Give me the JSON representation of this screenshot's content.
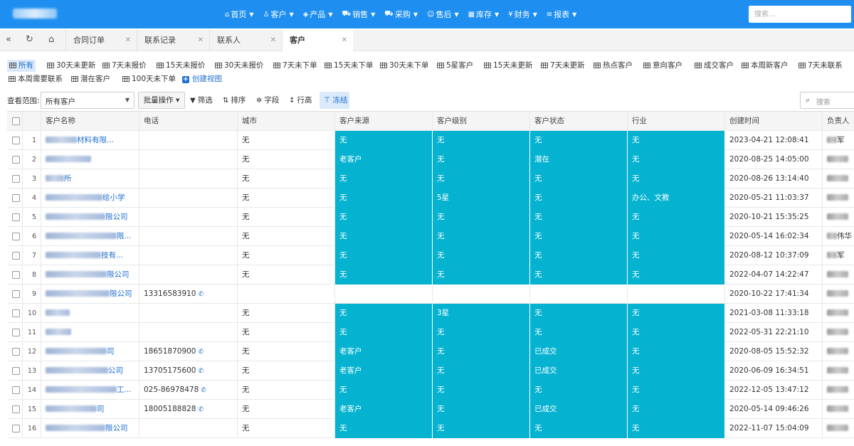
{
  "nav": {
    "items": [
      {
        "icon": "home-icon",
        "glyph": "⌂",
        "label": "首页"
      },
      {
        "icon": "user-icon",
        "glyph": "♙",
        "label": "客户"
      },
      {
        "icon": "cube-icon",
        "glyph": "◈",
        "label": "产品"
      },
      {
        "icon": "cart-icon",
        "glyph": "⛟",
        "label": "销售"
      },
      {
        "icon": "cart-icon",
        "glyph": "⛟",
        "label": "采购"
      },
      {
        "icon": "service-icon",
        "glyph": "☺",
        "label": "售后"
      },
      {
        "icon": "warehouse-icon",
        "glyph": "▦",
        "label": "库存"
      },
      {
        "icon": "finance-icon",
        "glyph": "¥",
        "label": "财务"
      },
      {
        "icon": "report-icon",
        "glyph": "≋",
        "label": "报表"
      }
    ],
    "search_placeholder": "搜索..."
  },
  "tabs": [
    {
      "label": "合同订单"
    },
    {
      "label": "联系记录"
    },
    {
      "label": "联系人"
    },
    {
      "label": "客户",
      "active": true
    }
  ],
  "views": [
    {
      "label": "所有",
      "active": true
    },
    {
      "label": "30天未更新"
    },
    {
      "label": "7天未报价"
    },
    {
      "label": "15天未报价"
    },
    {
      "label": "30天未报价"
    },
    {
      "label": "7天未下单"
    },
    {
      "label": "15天未下单"
    },
    {
      "label": "30天未下单"
    },
    {
      "label": "5星客户"
    },
    {
      "label": "15天未更新"
    },
    {
      "label": "7天未更新"
    },
    {
      "label": "热点客户"
    },
    {
      "label": "意向客户"
    },
    {
      "label": "成交客户"
    },
    {
      "label": "本周新客户"
    },
    {
      "label": "7天未联系"
    },
    {
      "label": "本周需要联系"
    },
    {
      "label": "潜在客户"
    },
    {
      "label": "100天未下单"
    },
    {
      "label": "创建视图",
      "create": true
    }
  ],
  "toolbar": {
    "scope_label": "查看范围:",
    "scope_value": "所有客户",
    "batch": "批量操作",
    "filter": "筛选",
    "sort": "排序",
    "fields": "字段",
    "row_height": "行高",
    "freeze": "冻结",
    "search_placeholder": "搜索"
  },
  "table": {
    "columns": [
      "客户名称",
      "电话",
      "城市",
      "客户来源",
      "客户级别",
      "客户状态",
      "行业",
      "创建时间",
      "负责人"
    ],
    "rows": [
      {
        "n": "1",
        "name": "材料有限...",
        "phone": "",
        "city": "无",
        "source": "无",
        "level": "无",
        "status": "无",
        "industry": "无",
        "created": "2023-04-21 12:08:41",
        "owner": "军",
        "cyan": true
      },
      {
        "n": "2",
        "name": "",
        "phone": "",
        "city": "无",
        "source": "老客户",
        "level": "无",
        "status": "潜在",
        "industry": "无",
        "created": "2020-08-25 14:05:00",
        "owner": "",
        "cyan": true
      },
      {
        "n": "3",
        "name": "所",
        "phone": "",
        "city": "无",
        "source": "无",
        "level": "无",
        "status": "无",
        "industry": "无",
        "created": "2020-08-26 13:14:40",
        "owner": "",
        "cyan": true
      },
      {
        "n": "4",
        "name": "绘小学",
        "phone": "",
        "city": "无",
        "source": "无",
        "level": "5星",
        "status": "无",
        "industry": "办公、文教",
        "created": "2020-05-21 11:03:37",
        "owner": "",
        "cyan": true
      },
      {
        "n": "5",
        "name": "限公司",
        "phone": "",
        "city": "无",
        "source": "无",
        "level": "无",
        "status": "无",
        "industry": "无",
        "created": "2020-10-21 15:35:25",
        "owner": "",
        "cyan": true
      },
      {
        "n": "6",
        "name": "限...",
        "phone": "",
        "city": "无",
        "source": "无",
        "level": "无",
        "status": "无",
        "industry": "无",
        "created": "2020-05-14 16:02:34",
        "owner": "伟华",
        "cyan": true
      },
      {
        "n": "7",
        "name": "技有...",
        "phone": "",
        "city": "无",
        "source": "无",
        "level": "无",
        "status": "无",
        "industry": "无",
        "created": "2020-08-12 10:37:09",
        "owner": "军",
        "cyan": true
      },
      {
        "n": "8",
        "name": "限公司",
        "phone": "",
        "city": "无",
        "source": "无",
        "level": "无",
        "status": "无",
        "industry": "无",
        "created": "2022-04-07 14:22:47",
        "owner": "",
        "cyan": true
      },
      {
        "n": "9",
        "name": "限公司",
        "phone": "13316583910",
        "city": "",
        "source": "",
        "level": "",
        "status": "",
        "industry": "",
        "created": "2020-10-22 17:41:34",
        "owner": "",
        "cyan": false
      },
      {
        "n": "10",
        "name": "",
        "phone": "",
        "city": "无",
        "source": "无",
        "level": "3星",
        "status": "无",
        "industry": "无",
        "created": "2021-03-08 11:33:18",
        "owner": "",
        "cyan": true
      },
      {
        "n": "11",
        "name": "",
        "phone": "",
        "city": "无",
        "source": "无",
        "level": "无",
        "status": "无",
        "industry": "无",
        "created": "2022-05-31 22:21:10",
        "owner": "",
        "cyan": true
      },
      {
        "n": "12",
        "name": "司",
        "phone": "18651870900",
        "city": "无",
        "source": "老客户",
        "level": "无",
        "status": "已成交",
        "industry": "无",
        "created": "2020-08-05 15:52:32",
        "owner": "",
        "cyan": true
      },
      {
        "n": "13",
        "name": "公司",
        "phone": "13705175600",
        "city": "无",
        "source": "老客户",
        "level": "无",
        "status": "已成交",
        "industry": "无",
        "created": "2020-06-09 16:34:51",
        "owner": "",
        "cyan": true
      },
      {
        "n": "14",
        "name": "工...",
        "phone": "025-86978478",
        "city": "无",
        "source": "无",
        "level": "无",
        "status": "无",
        "industry": "无",
        "created": "2022-12-05 13:47:12",
        "owner": "",
        "cyan": true
      },
      {
        "n": "15",
        "name": "司",
        "phone": "18005188828",
        "city": "无",
        "source": "老客户",
        "level": "无",
        "status": "已成交",
        "industry": "无",
        "created": "2020-05-14 09:46:26",
        "owner": "",
        "cyan": true
      },
      {
        "n": "16",
        "name": "限公司",
        "phone": "",
        "city": "无",
        "source": "无",
        "level": "无",
        "status": "无",
        "industry": "无",
        "created": "2022-11-07 15:04:09",
        "owner": "",
        "cyan": true
      }
    ]
  },
  "colors": {
    "brand": "#1e8ff0",
    "highlight": "#05b3d1",
    "link": "#1e6fd0"
  }
}
